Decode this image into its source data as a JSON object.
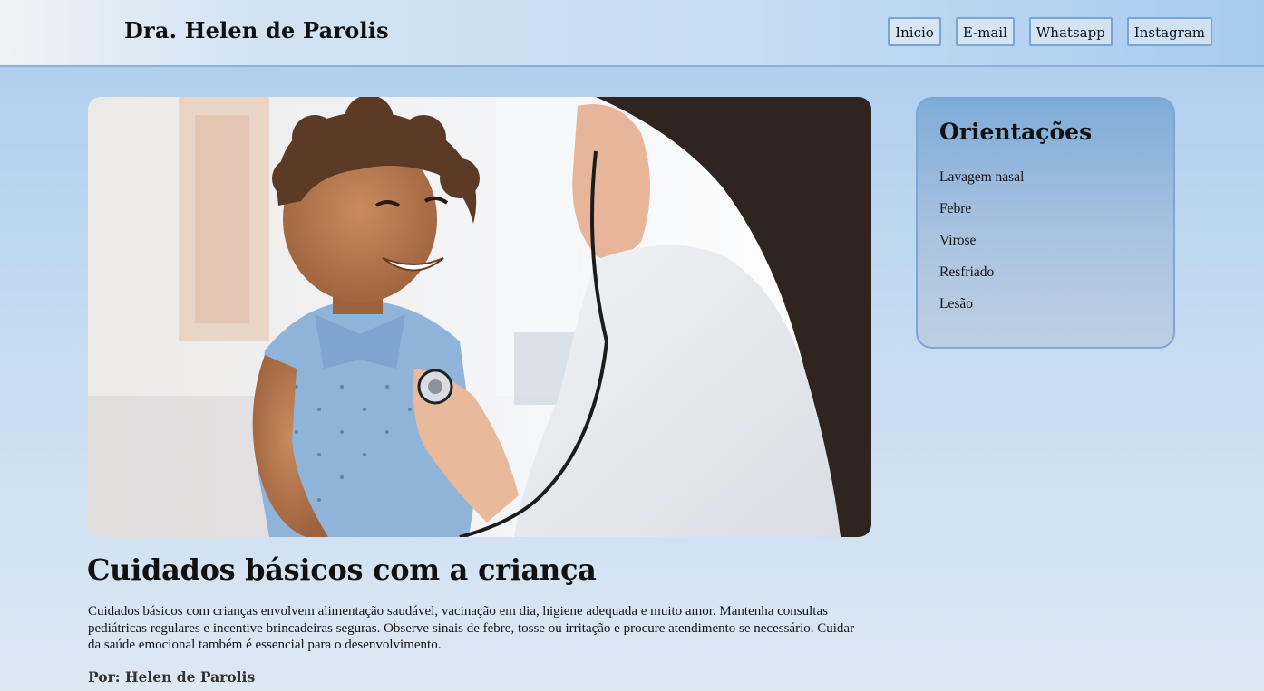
{
  "header": {
    "title": "Dra. Helen de Parolis",
    "nav": [
      "Inicio",
      "E-mail",
      "Whatsapp",
      "Instagram"
    ]
  },
  "hero": {
    "image": "photo of smiling child being examined with stethoscope by doctor"
  },
  "article": {
    "title": "Cuidados básicos com a criança",
    "body": "Cuidados básicos com crianças envolvem alimentação saudável, vacinação em dia, higiene adequada e muito amor. Mantenha consultas pediátricas regulares e incentive brincadeiras seguras. Observe sinais de febre, tosse ou irritação e procure atendimento se necessário. Cuidar da saúde emocional também é essencial para o desenvolvimento.",
    "byline": "Por: Helen de Parolis"
  },
  "sidebar": {
    "title": "Orientações",
    "items": [
      "Lavagem nasal",
      "Febre",
      "Virose",
      "Resfriado",
      "Lesão"
    ]
  },
  "colors": {
    "accent_border": "#7ba4cf",
    "page_top": "#a9cdee",
    "page_bottom": "#dde8f3"
  }
}
